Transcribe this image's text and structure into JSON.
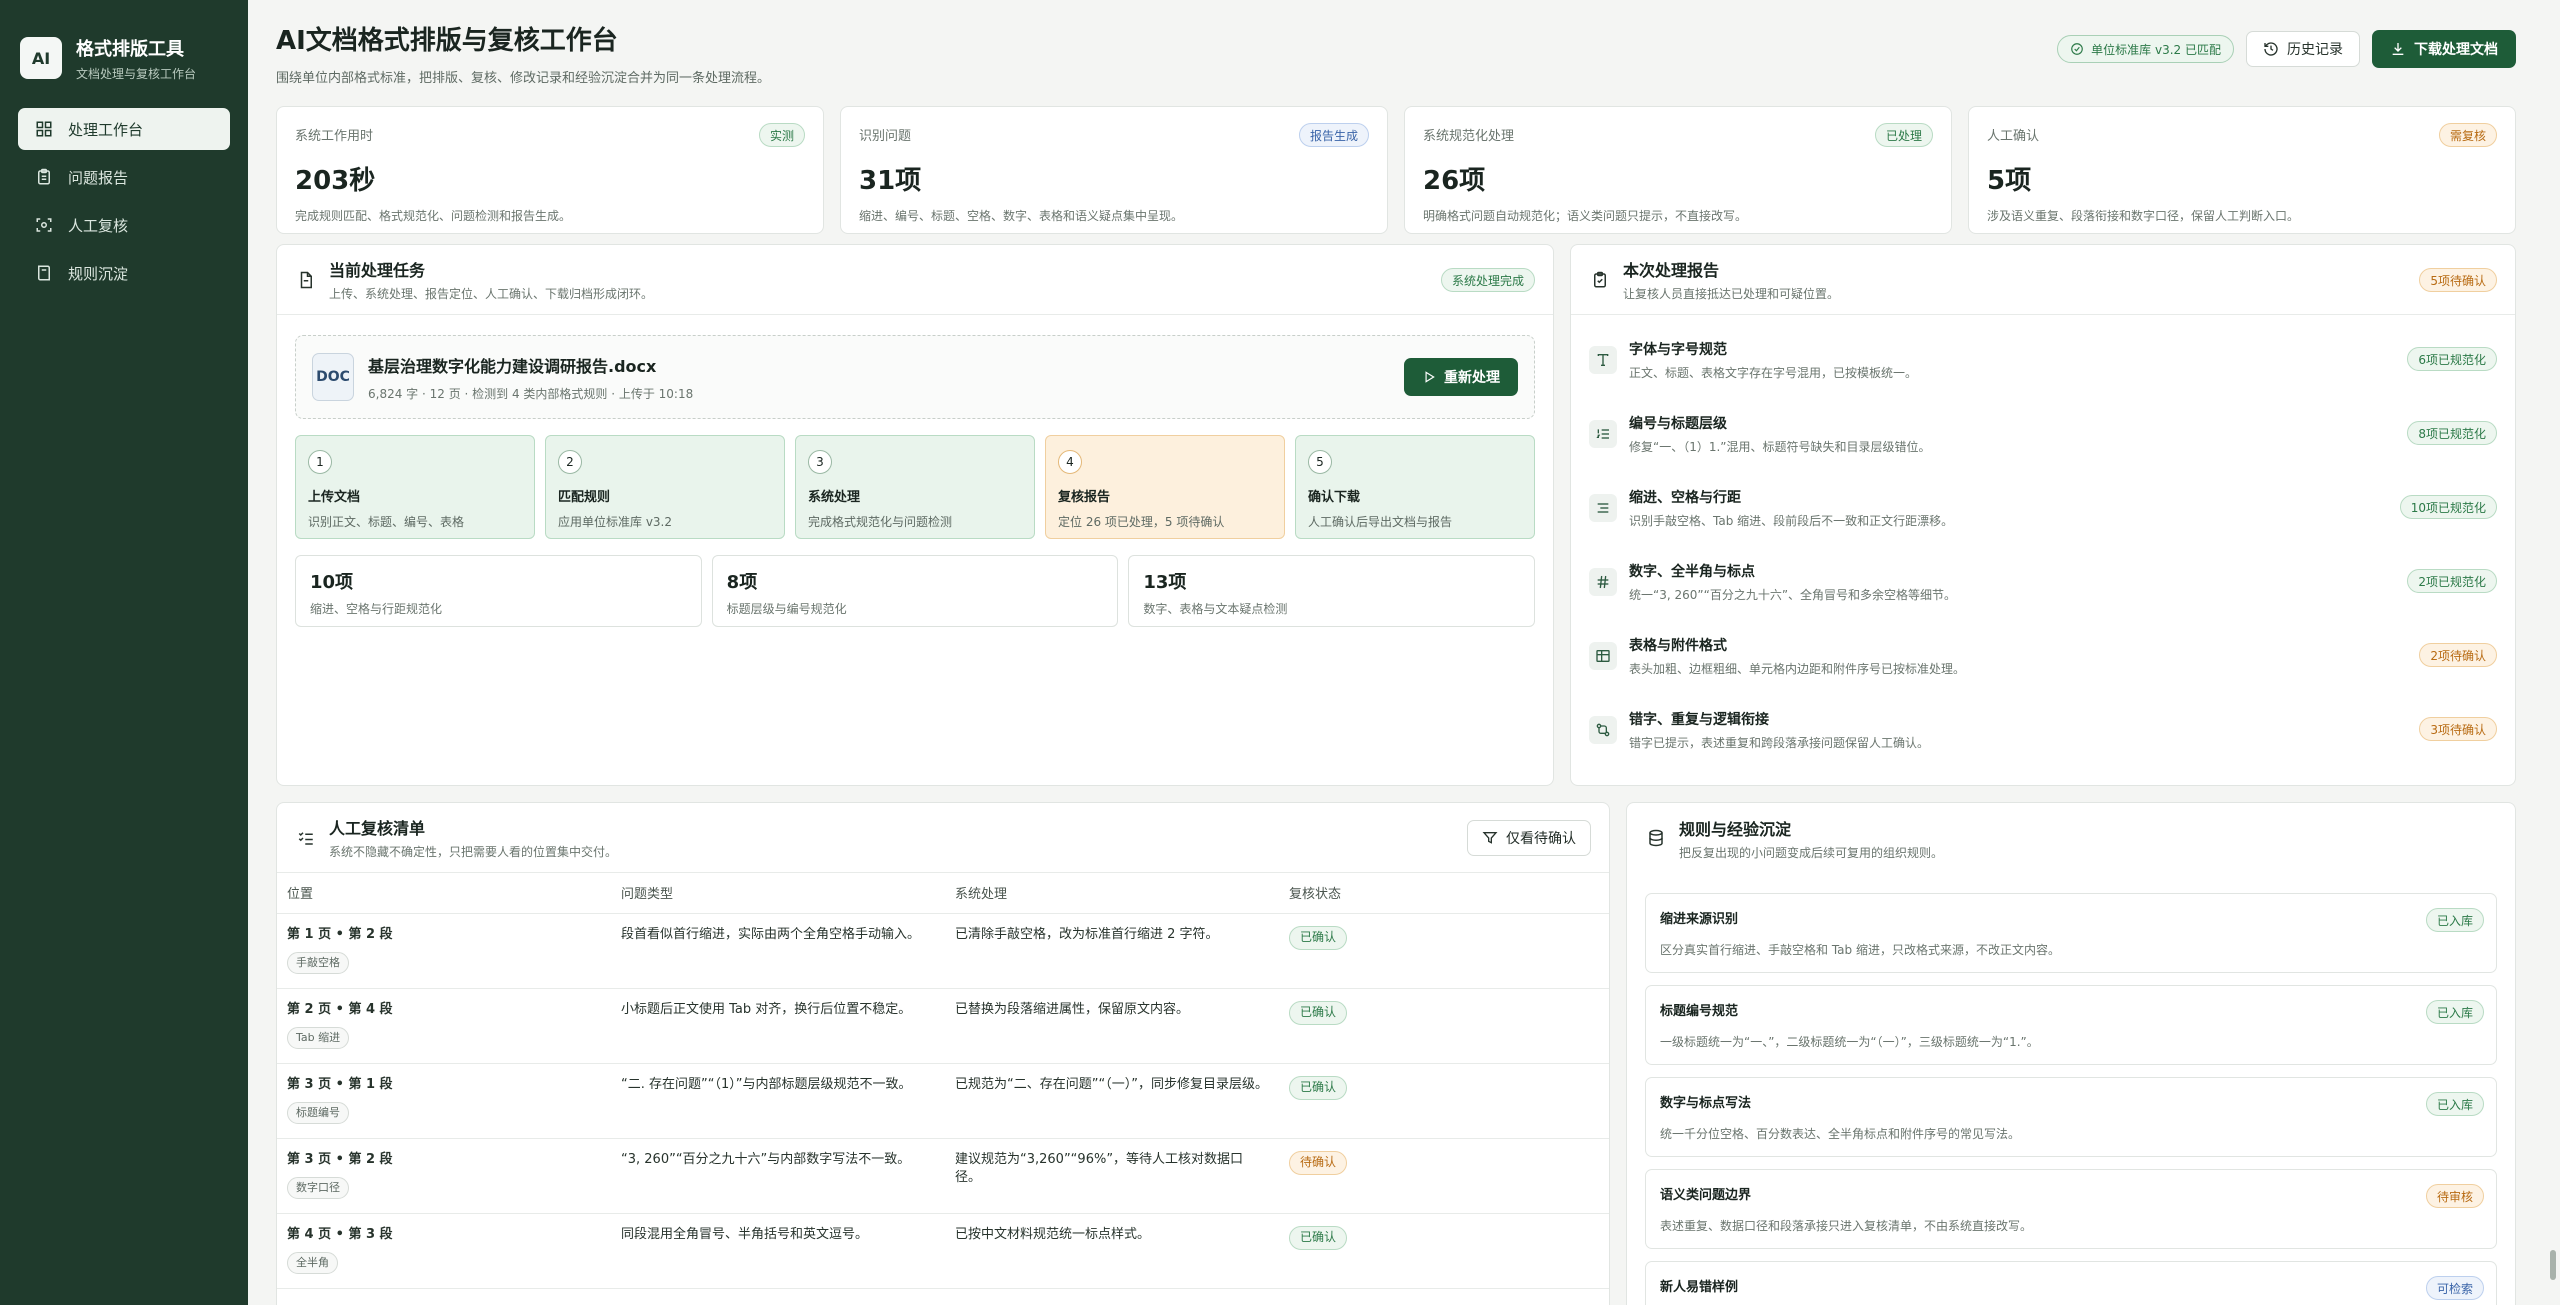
{
  "brand": {
    "logo": "AI",
    "name": "格式排版工具",
    "sub": "文档处理与复核工作台"
  },
  "nav": [
    {
      "label": "处理工作台",
      "icon": "grid-icon"
    },
    {
      "label": "问题报告",
      "icon": "clipboard-icon"
    },
    {
      "label": "人工复核",
      "icon": "scan-icon"
    },
    {
      "label": "规则沉淀",
      "icon": "book-icon"
    }
  ],
  "header": {
    "title": "AI文档格式排版与复核工作台",
    "subtitle": "围绕单位内部格式标准，把排版、复核、修改记录和经验沉淀合并为同一条处理流程。",
    "match_badge": "单位标准库 v3.2 已匹配",
    "history_label": "历史记录",
    "download_label": "下载处理文档"
  },
  "stats": [
    {
      "label": "系统工作用时",
      "value": "203秒",
      "desc": "完成规则匹配、格式规范化、问题检测和报告生成。",
      "tag": "实测",
      "tag_color": "green"
    },
    {
      "label": "识别问题",
      "value": "31项",
      "desc": "缩进、编号、标题、空格、数字、表格和语义疑点集中呈现。",
      "tag": "报告生成",
      "tag_color": "blue"
    },
    {
      "label": "系统规范化处理",
      "value": "26项",
      "desc": "明确格式问题自动规范化；语义类问题只提示，不直接改写。",
      "tag": "已处理",
      "tag_color": "green"
    },
    {
      "label": "人工确认",
      "value": "5项",
      "desc": "涉及语义重复、段落衔接和数字口径，保留人工判断入口。",
      "tag": "需复核",
      "tag_color": "orange"
    }
  ],
  "task": {
    "title": "当前处理任务",
    "subtitle": "上传、系统处理、报告定位、人工确认、下载归档形成闭环。",
    "tag": "系统处理完成",
    "file": {
      "type": "DOC",
      "name": "基层治理数字化能力建设调研报告.docx",
      "meta": "6,824 字 · 12 页 · 检测到 4 类内部格式规则 · 上传于 10:18",
      "redo_label": "重新处理"
    },
    "steps": [
      {
        "num": "1",
        "title": "上传文档",
        "desc": "识别正文、标题、编号、表格"
      },
      {
        "num": "2",
        "title": "匹配规则",
        "desc": "应用单位标准库 v3.2"
      },
      {
        "num": "3",
        "title": "系统处理",
        "desc": "完成格式规范化与问题检测"
      },
      {
        "num": "4",
        "title": "复核报告",
        "desc": "定位 26 项已处理，5 项待确认"
      },
      {
        "num": "5",
        "title": "确认下载",
        "desc": "人工确认后导出文档与报告"
      }
    ],
    "minis": [
      {
        "value": "10项",
        "desc": "缩进、空格与行距规范化"
      },
      {
        "value": "8项",
        "desc": "标题层级与编号规范化"
      },
      {
        "value": "13项",
        "desc": "数字、表格与文本疑点检测"
      }
    ]
  },
  "report": {
    "title": "本次处理报告",
    "subtitle": "让复核人员直接抵达已处理和可疑位置。",
    "tag": "5项待确认",
    "items": [
      {
        "icon": "type-icon",
        "title": "字体与字号规范",
        "desc": "正文、标题、表格文字存在字号混用，已按模板统一。",
        "tag": "6项已规范化",
        "tag_color": "green"
      },
      {
        "icon": "list-numbered-icon",
        "title": "编号与标题层级",
        "desc": "修复“一、（1）1.”混用、标题符号缺失和目录层级错位。",
        "tag": "8项已规范化",
        "tag_color": "green"
      },
      {
        "icon": "align-icon",
        "title": "缩进、空格与行距",
        "desc": "识别手敲空格、Tab 缩进、段前段后不一致和正文行距漂移。",
        "tag": "10项已规范化",
        "tag_color": "green"
      },
      {
        "icon": "hash-icon",
        "title": "数字、全半角与标点",
        "desc": "统一“3, 260”“百分之九十六”、全角冒号和多余空格等细节。",
        "tag": "2项已规范化",
        "tag_color": "green"
      },
      {
        "icon": "table-icon",
        "title": "表格与附件格式",
        "desc": "表头加粗、边框粗细、单元格内边距和附件序号已按标准处理。",
        "tag": "2项待确认",
        "tag_color": "orange"
      },
      {
        "icon": "flow-icon",
        "title": "错字、重复与逻辑衔接",
        "desc": "错字已提示，表述重复和跨段落承接问题保留人工确认。",
        "tag": "3项待确认",
        "tag_color": "orange"
      }
    ]
  },
  "review": {
    "title": "人工复核清单",
    "subtitle": "系统不隐藏不确定性，只把需要人看的位置集中交付。",
    "filter_label": "仅看待确认",
    "columns": [
      "位置",
      "问题类型",
      "系统处理",
      "复核状态"
    ],
    "rows": [
      {
        "loc": "第 1 页 • 第 2 段",
        "loc_tag": "手敲空格",
        "issue": "段首看似首行缩进，实际由两个全角空格手动输入。",
        "fix": "已清除手敲空格，改为标准首行缩进 2 字符。",
        "status": "已确认",
        "status_color": "green"
      },
      {
        "loc": "第 2 页 • 第 4 段",
        "loc_tag": "Tab 缩进",
        "issue": "小标题后正文使用 Tab 对齐，换行后位置不稳定。",
        "fix": "已替换为段落缩进属性，保留原文内容。",
        "status": "已确认",
        "status_color": "green"
      },
      {
        "loc": "第 3 页 • 第 1 段",
        "loc_tag": "标题编号",
        "issue": "“二. 存在问题”“（1）”与内部标题层级规范不一致。",
        "fix": "已规范为“二、存在问题”“（一）”，同步修复目录层级。",
        "status": "已确认",
        "status_color": "green"
      },
      {
        "loc": "第 3 页 • 第 2 段",
        "loc_tag": "数字口径",
        "issue": "“3, 260”“百分之九十六”与内部数字写法不一致。",
        "fix": "建议规范为“3,260”“96%”，等待人工核对数据口径。",
        "status": "待确认",
        "status_color": "orange"
      },
      {
        "loc": "第 4 页 • 第 3 段",
        "loc_tag": "全半角",
        "issue": "同段混用全角冒号、半角括号和英文逗号。",
        "fix": "已按中文材料规范统一标点样式。",
        "status": "已确认",
        "status_color": "green"
      }
    ]
  },
  "rules": {
    "title": "规则与经验沉淀",
    "subtitle": "把反复出现的小问题变成后续可复用的组织规则。",
    "items": [
      {
        "title": "缩进来源识别",
        "desc": "区分真实首行缩进、手敲空格和 Tab 缩进，只改格式来源，不改正文内容。",
        "tag": "已入库",
        "tag_color": "green"
      },
      {
        "title": "标题编号规范",
        "desc": "一级标题统一为“一、”，二级标题统一为“（一）”，三级标题统一为“1.”。",
        "tag": "已入库",
        "tag_color": "green"
      },
      {
        "title": "数字与标点写法",
        "desc": "统一千分位空格、百分数表达、全半角标点和附件序号的常见写法。",
        "tag": "已入库",
        "tag_color": "green"
      },
      {
        "title": "语义类问题边界",
        "desc": "表述重复、数据口径和段落承接只进入复核清单，不由系统直接改写。",
        "tag": "待审核",
        "tag_color": "orange"
      },
      {
        "title": "新人易错样例",
        "desc": "",
        "tag": "可检索",
        "tag_color": "blue"
      }
    ]
  }
}
